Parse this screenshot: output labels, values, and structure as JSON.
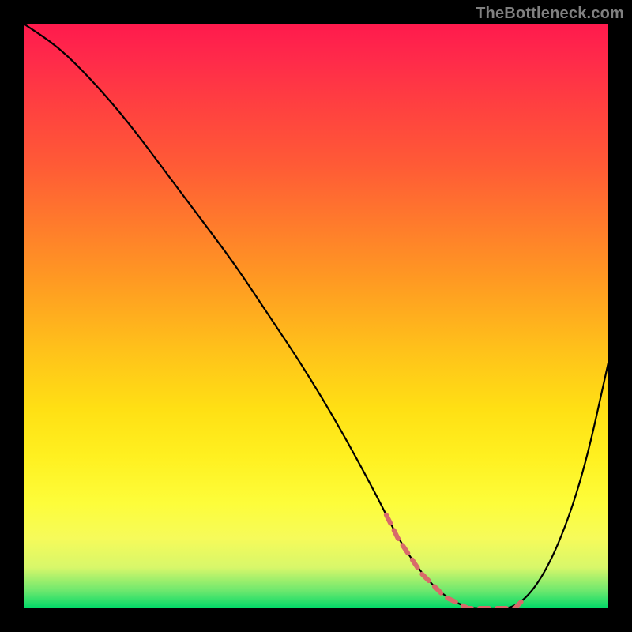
{
  "watermark": "TheBottleneck.com",
  "chart_data": {
    "type": "line",
    "title": "",
    "xlabel": "",
    "ylabel": "",
    "xlim": [
      0,
      100
    ],
    "ylim": [
      0,
      100
    ],
    "gradient_colors": {
      "top": "#ff1a4d",
      "mid_upper": "#ff9a22",
      "mid_lower": "#fff020",
      "bottom": "#00d968"
    },
    "series": [
      {
        "name": "bottleneck-curve",
        "x": [
          0,
          6,
          12,
          18,
          24,
          30,
          36,
          42,
          48,
          54,
          60,
          64,
          68,
          72,
          76,
          80,
          84,
          88,
          92,
          96,
          100
        ],
        "values": [
          100,
          96,
          90,
          83,
          75,
          67,
          59,
          50,
          41,
          31,
          20,
          12,
          6,
          2,
          0,
          0,
          0,
          4,
          12,
          24,
          42
        ]
      }
    ],
    "optimal_range": {
      "x_start": 62,
      "x_end": 86,
      "note": "coral dashed segment at curve minimum"
    },
    "annotations": []
  }
}
